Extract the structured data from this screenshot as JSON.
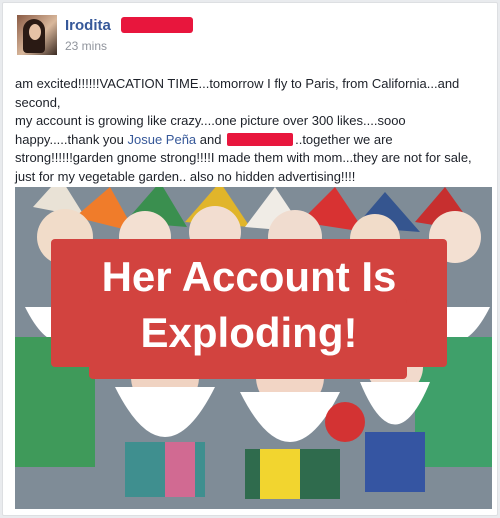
{
  "post": {
    "author_name": "Irodita",
    "timestamp": "23 mins",
    "text_1": "am excited!!!!!!VACATION TIME...tomorrow I fly to Paris, from California...and second,",
    "text_2": "my account is growing like crazy....one picture over 300 likes....sooo happy.....thank you ",
    "mention": "Josue Peña",
    "text_3": " and ",
    "text_4": "..together we are strong!!!!!!garden gnome strong!!!!I made them with mom...they are not for sale, just for my vegetable garden.. also no hidden advertising!!!!"
  },
  "overlay": {
    "line1": "Her Account Is",
    "line2": "Exploding!"
  },
  "colors": {
    "banner": "#d2433f",
    "redaction": "#e8163d",
    "link": "#365899"
  },
  "icons": [
    "avatar-photo",
    "garden-gnome-photo"
  ]
}
